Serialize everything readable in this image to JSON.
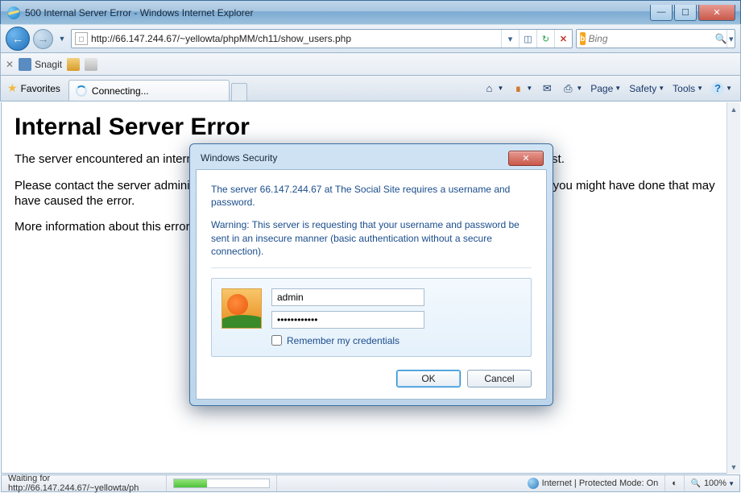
{
  "window": {
    "title": "500 Internal Server Error - Windows Internet Explorer"
  },
  "nav": {
    "url": "http://66.147.244.67/~yellowta/phpMM/ch11/show_users.php",
    "search_provider": "Bing",
    "search_placeholder": "Bing"
  },
  "toolbar": {
    "snagit_label": "Snagit"
  },
  "favorites": {
    "label": "Favorites"
  },
  "tab": {
    "label": "Connecting..."
  },
  "cmdbar": {
    "page": "Page",
    "safety": "Safety",
    "tools": "Tools"
  },
  "page": {
    "heading": "Internal Server Error",
    "p1": "The server encountered an internal error or misconfiguration and was unable to complete your request.",
    "p2": "Please contact the server administrator and inform them of the time the error occurred, and anything you might have done that may have caused the error.",
    "p3": "More information about this error may be available in the server error log."
  },
  "dialog": {
    "title": "Windows Security",
    "msg1": "The server 66.147.244.67 at The Social Site requires a username and password.",
    "msg2": "Warning: This server is requesting that your username and password be sent in an insecure manner (basic authentication without a secure connection).",
    "username": "admin",
    "password": "••••••••••••",
    "remember": "Remember my credentials",
    "ok": "OK",
    "cancel": "Cancel"
  },
  "status": {
    "waiting": "Waiting for http://66.147.244.67/~yellowta/ph",
    "zone": "Internet | Protected Mode: On",
    "zoom": "100%"
  }
}
